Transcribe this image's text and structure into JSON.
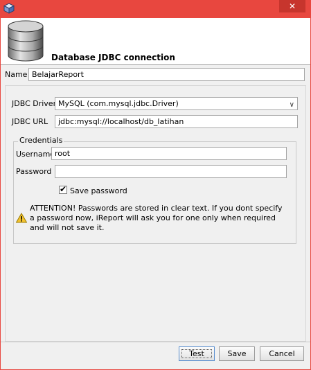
{
  "window": {
    "close_glyph": "✕"
  },
  "header": {
    "title": "Database JDBC connection"
  },
  "form": {
    "name_label": "Name",
    "name_value": "BelajarReport",
    "driver_label": "JDBC Driver",
    "driver_value": "MySQL (com.mysql.jdbc.Driver)",
    "url_label": "JDBC URL",
    "url_value": "jdbc:mysql://localhost/db_latihan"
  },
  "credentials": {
    "legend": "Credentials",
    "username_label": "Username",
    "username_value": "root",
    "password_label": "Password",
    "password_value": "",
    "save_password_label": "Save password",
    "save_password_checked": true,
    "warning": "ATTENTION! Passwords are stored in clear text. If you dont specify a password now, iReport will ask you for one only when required and will not save it."
  },
  "buttons": {
    "test": "Test",
    "save": "Save",
    "cancel": "Cancel"
  },
  "icons": {
    "app": "app-cube-icon",
    "database": "database-icon",
    "warning": "warning-icon",
    "dropdown": "chevron-down-icon",
    "check": "checkmark-icon"
  },
  "colors": {
    "frame": "#e8473f",
    "close_button": "#c7352d",
    "focus_border": "#5a8fcf"
  }
}
